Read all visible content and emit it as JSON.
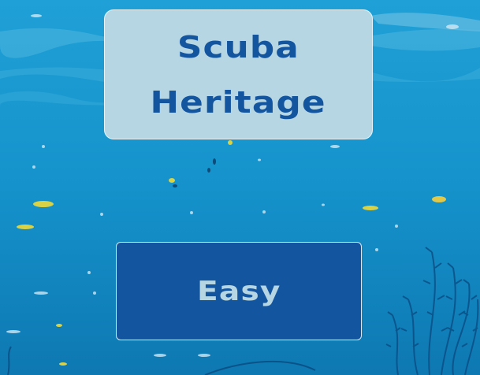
{
  "title": {
    "line1": "Scuba",
    "line2": "Heritage"
  },
  "difficulty_button": {
    "label": "Easy"
  },
  "background": {
    "description_icon": "underwater-scene",
    "water_top": "#1b9ad3",
    "water_bottom": "#0e6fa6",
    "particle_color": "#e6d64a",
    "seaweed_color": "#0b4f86"
  },
  "colors": {
    "card_bg": "#b7d6e3",
    "title_text": "#1455a0",
    "button_bg": "#1455a0",
    "button_text": "#b7d6e3"
  }
}
